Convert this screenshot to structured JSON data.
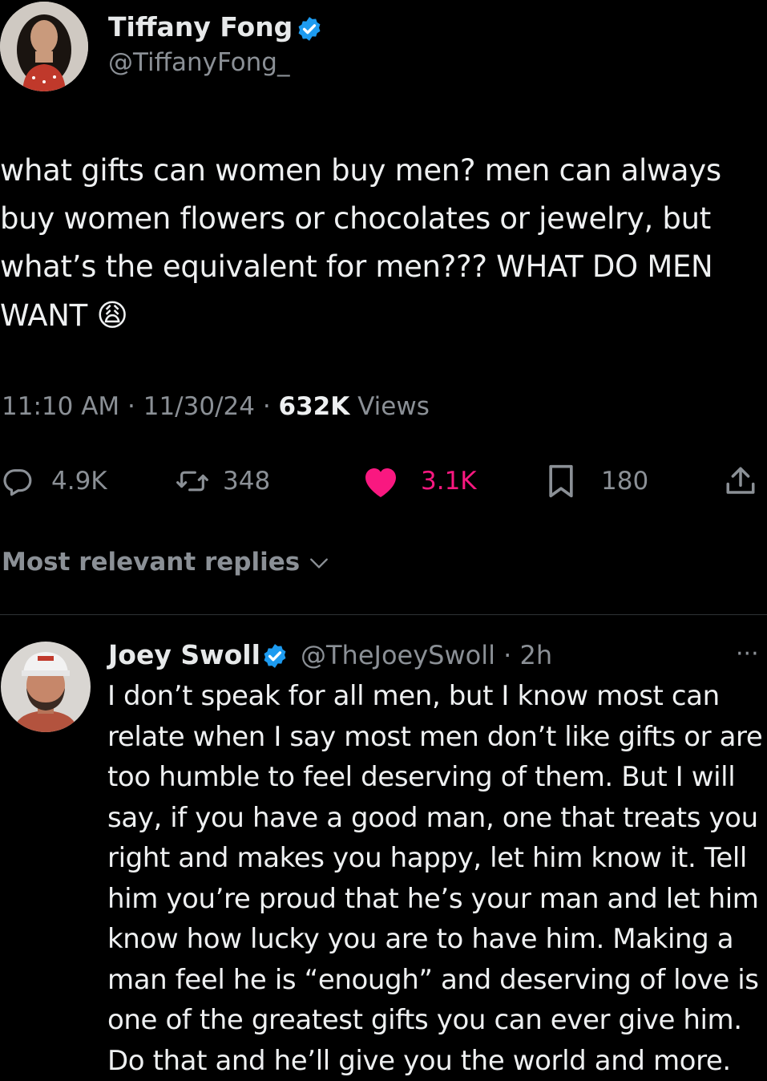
{
  "tweet": {
    "author_name": "Tiffany Fong",
    "author_handle": "@TiffanyFong_",
    "text": "what gifts can women buy men? men can always buy women flowers or chocolates or jewelry, but what’s the equivalent for men??? WHAT DO MEN WANT",
    "emoji": "😩",
    "time": "11:10 AM",
    "date": "11/30/24",
    "views_count": "632K",
    "views_label": "Views",
    "replies": "4.9K",
    "reposts": "348",
    "likes": "3.1K",
    "bookmarks": "180"
  },
  "sort_label": "Most relevant replies",
  "reply": {
    "author_name": "Joey Swoll",
    "author_handle": "@TheJoeySwoll",
    "age": "2h",
    "more": "···",
    "text": "I don’t speak for all men, but I know most can relate when I say most men don’t like gifts or are too humble to feel deserving of them. But I will say, if you have a good man, one that treats you right and makes you happy, let him know it. Tell him you’re proud that he’s your man and let him know how lucky you are to have him. Making a man feel he is “enough” and deserving of love is one of the greatest gifts you can ever give him. Do that and he’ll give you the world and more."
  },
  "colors": {
    "background": "#000000",
    "text": "#e7e9ea",
    "secondary": "#8b9096",
    "like_pink": "#f91880",
    "verified_blue": "#1d9bf0"
  },
  "icons": [
    "reply-icon",
    "repost-icon",
    "like-icon",
    "bookmark-icon",
    "share-icon",
    "verified-badge-icon",
    "chevron-down-icon",
    "more-icon"
  ]
}
